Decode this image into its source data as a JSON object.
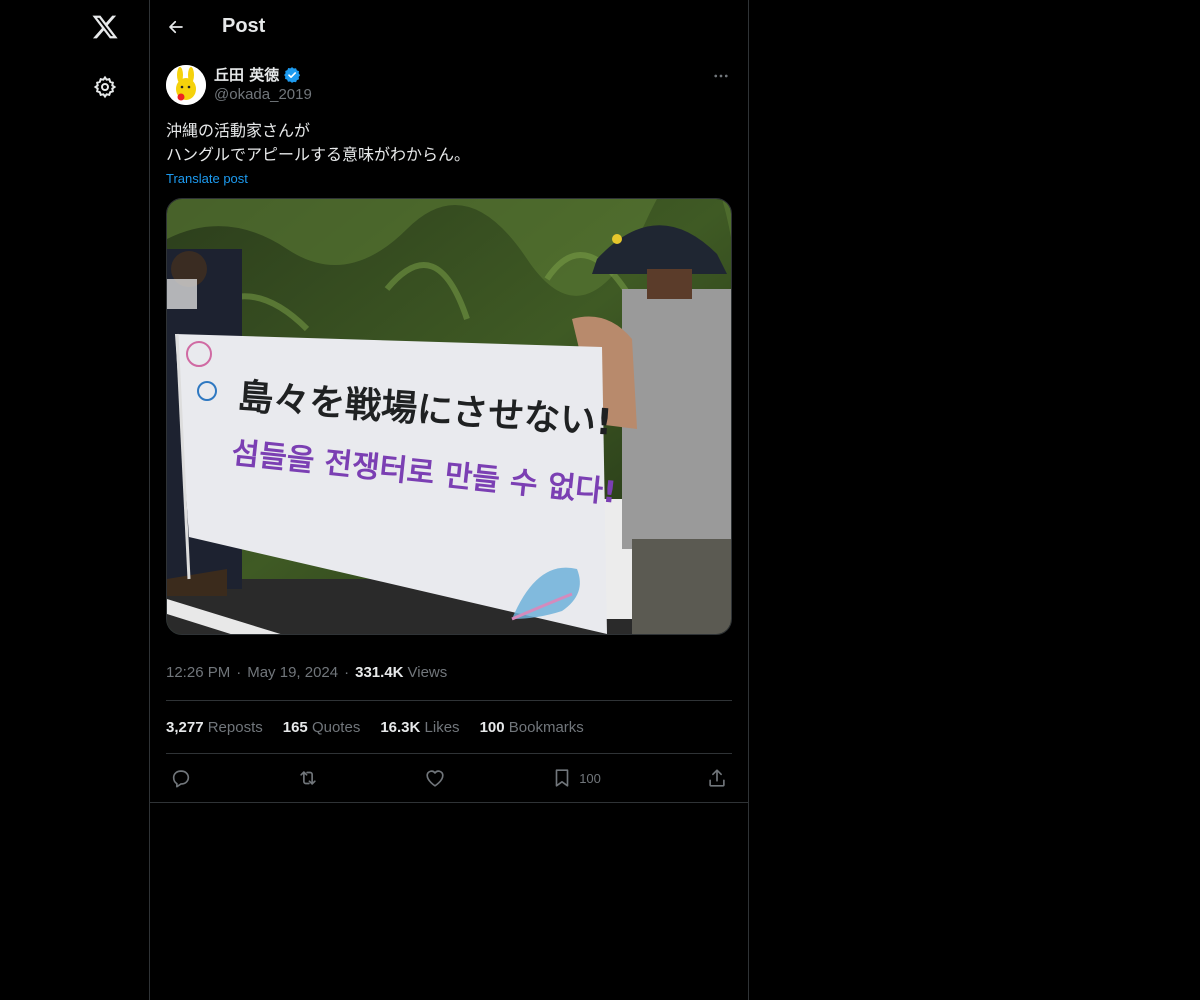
{
  "header": {
    "title": "Post"
  },
  "author": {
    "display_name": "丘田 英徳",
    "handle": "@okada_2019",
    "verified": true
  },
  "post": {
    "text": "沖縄の活動家さんが\nハングルでアピールする意味がわからん。",
    "translate_label": "Translate post",
    "media_banner_japanese": "島々を戦場にさせない!",
    "media_banner_korean": "섬들을 전쟁터로 만들 수 없다!"
  },
  "meta": {
    "time": "12:26 PM",
    "sep1": "·",
    "date": "May 19, 2024",
    "sep2": "·",
    "views_count": "331.4K",
    "views_label": "Views"
  },
  "stats": {
    "reposts_count": "3,277",
    "reposts_label": "Reposts",
    "quotes_count": "165",
    "quotes_label": "Quotes",
    "likes_count": "16.3K",
    "likes_label": "Likes",
    "bookmarks_count": "100",
    "bookmarks_label": "Bookmarks"
  },
  "actions": {
    "bookmark_count": "100"
  },
  "icons": [
    "x-logo-icon",
    "gear-icon",
    "back-arrow-icon",
    "verified-badge-icon",
    "more-icon",
    "reply-icon",
    "repost-icon",
    "like-icon",
    "bookmark-icon",
    "share-icon"
  ],
  "colors": {
    "accent": "#1d9bf0",
    "background": "#000000",
    "text": "#e7e9ea",
    "muted": "#71767b",
    "border": "#2f3336"
  }
}
